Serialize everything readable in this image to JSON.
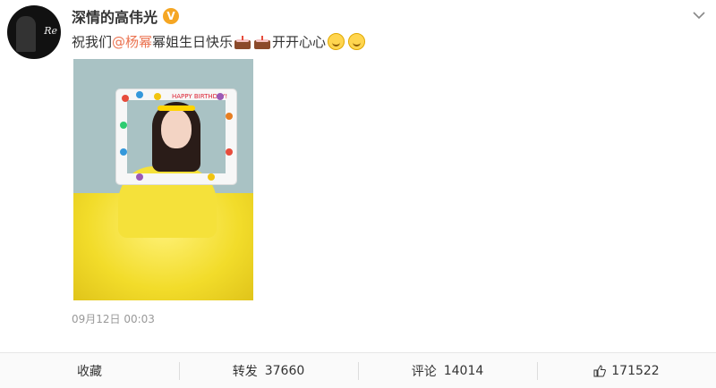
{
  "post": {
    "author": "深情的高伟光",
    "verified_mark": "V",
    "content_prefix": "祝我们",
    "mention": "@杨幂",
    "content_middle": " 幂姐生日快乐",
    "content_suffix": "开开心心",
    "timestamp": "09月12日 00:03",
    "photo_caption": "HAPPY BIRTHDAY!"
  },
  "actions": {
    "favorite_label": "收藏",
    "repost_label": "转发",
    "repost_count": "37660",
    "comment_label": "评论",
    "comment_count": "14014",
    "like_count": "171522"
  },
  "icons": {
    "menu": "chevron-down-icon",
    "verified": "verified-badge-icon",
    "like": "thumb-up-icon"
  },
  "colors": {
    "mention": "#eb7350",
    "verified": "#f5a623"
  }
}
